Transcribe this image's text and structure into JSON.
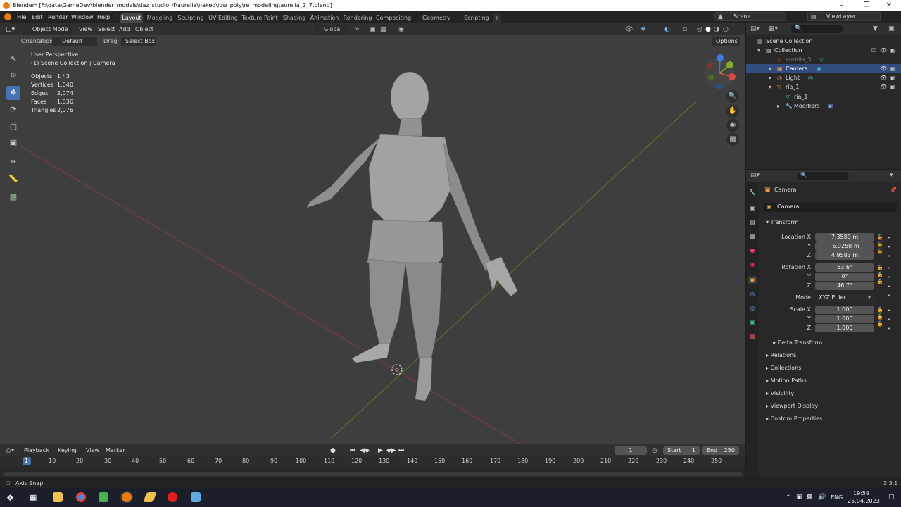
{
  "window": {
    "title": "Blender* [F:\\data\\GameDev\\blender_models\\daz_studio_4\\aurelia\\naked\\low_poly\\re_modeling\\aurelia_2_7.blend]"
  },
  "menu": [
    "File",
    "Edit",
    "Render",
    "Window",
    "Help"
  ],
  "workspaces": [
    "Layout",
    "Modeling",
    "Sculpting",
    "UV Editing",
    "Texture Paint",
    "Shading",
    "Animation",
    "Rendering",
    "Compositing",
    "Geometry Nodes",
    "Scripting"
  ],
  "scene": {
    "name": "Scene",
    "view_layer": "ViewLayer"
  },
  "viewport": {
    "mode": "Object Mode",
    "menus": [
      "View",
      "Select",
      "Add",
      "Object"
    ],
    "transform_orientation": "Global",
    "orientation_label": "Orientation:",
    "orientation_value": "Default",
    "drag_label": "Drag:",
    "drag_value": "Select Box",
    "options": "Options",
    "perspective": "User Perspective",
    "collection_info": "(1) Scene Collection | Camera",
    "stats": [
      {
        "label": "Objects",
        "value": "1 / 3"
      },
      {
        "label": "Vertices",
        "value": "1,040"
      },
      {
        "label": "Edges",
        "value": "2,074"
      },
      {
        "label": "Faces",
        "value": "1,036"
      },
      {
        "label": "Triangles",
        "value": "2,076"
      }
    ]
  },
  "outliner": {
    "rows": [
      {
        "label": "Scene Collection",
        "icon": "scene-collection-icon"
      },
      {
        "label": "Collection",
        "icon": "collection-icon"
      },
      {
        "label": "aurelia_3",
        "icon": "mesh-icon"
      },
      {
        "label": "Camera",
        "icon": "camera-icon"
      },
      {
        "label": "Light",
        "icon": "light-icon"
      },
      {
        "label": "ria_1",
        "icon": "mesh-icon"
      },
      {
        "label": "ria_1",
        "icon": "mesh-data-icon"
      },
      {
        "label": "Modifiers",
        "icon": "wrench-icon"
      }
    ]
  },
  "properties": {
    "object_name": "Camera",
    "name_field": "Camera",
    "transform_header": "Transform",
    "location": {
      "label": "Location X",
      "x": "7.3589 m",
      "y": "-6.9258 m",
      "z": "4.9583 m"
    },
    "rotation": {
      "label": "Rotation X",
      "x": "63.6°",
      "y": "0°",
      "z": "46.7°"
    },
    "mode_label": "Mode",
    "mode_value": "XYZ Euler",
    "scale": {
      "label": "Scale X",
      "x": "1.000",
      "y": "1.000",
      "z": "1.000"
    },
    "axis_y": "Y",
    "axis_z": "Z",
    "delta": "Delta Transform",
    "sections": [
      "Relations",
      "Collections",
      "Motion Paths",
      "Visibility",
      "Viewport Display",
      "Custom Properties"
    ]
  },
  "timeline": {
    "menus": [
      "Playback",
      "Keying",
      "View",
      "Marker"
    ],
    "current_frame": "1",
    "start_label": "Start",
    "start": "1",
    "end_label": "End",
    "end": "250",
    "ticks": [
      "1",
      "10",
      "20",
      "30",
      "40",
      "50",
      "60",
      "70",
      "80",
      "90",
      "100",
      "110",
      "120",
      "130",
      "140",
      "150",
      "160",
      "170",
      "180",
      "190",
      "200",
      "210",
      "220",
      "230",
      "240",
      "250"
    ]
  },
  "status": {
    "hint": "Axis Snap",
    "version": "3.3.1"
  },
  "taskbar": {
    "lang": "ENG",
    "time": "19:59",
    "date": "25.04.2023"
  },
  "colors": {
    "accent": "#4772b3",
    "selection": "#334d80",
    "blender_orange": "#e87d0d"
  }
}
